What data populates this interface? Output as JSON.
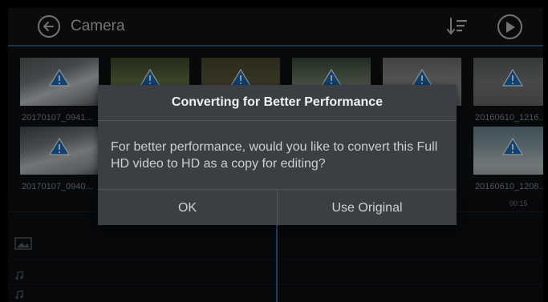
{
  "header": {
    "title": "Camera",
    "back_icon": "arrow-left-circle-icon",
    "sort_icon": "sort-icon",
    "play_icon": "play-circle-icon"
  },
  "thumbnails": [
    {
      "label": "20170107_0941..."
    },
    {
      "label": ""
    },
    {
      "label": ""
    },
    {
      "label": ""
    },
    {
      "label": ""
    },
    {
      "label": "20160610_1216..."
    },
    {
      "label": "20170107_0940..."
    },
    {
      "label": "20160610_1208..."
    }
  ],
  "timeline": {
    "time_label": "00:15"
  },
  "dialog": {
    "title": "Converting for Better Performance",
    "message": "For better performance, would you like to convert this Full HD video to HD as a copy for editing?",
    "ok_label": "OK",
    "original_label": "Use Original"
  },
  "colors": {
    "accent": "#1f5e93",
    "warning_icon": "#1a73c9",
    "dialog_bg": "#3b3e42"
  }
}
